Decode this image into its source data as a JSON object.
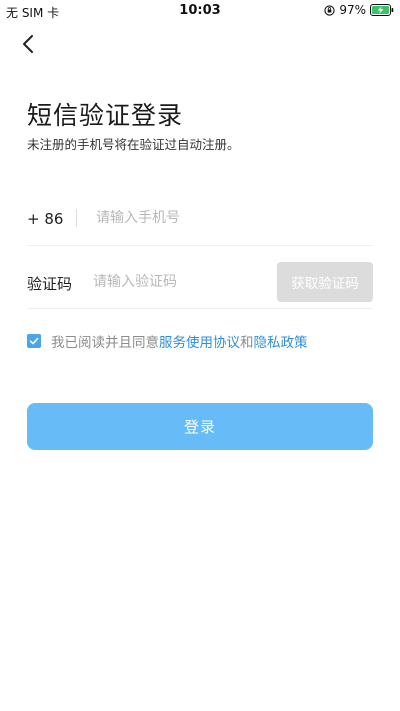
{
  "status_bar": {
    "carrier": "无 SIM 卡",
    "time": "10:03",
    "battery": "97%",
    "icons": [
      "rotation-lock-icon",
      "battery-charging-icon"
    ]
  },
  "nav": {
    "back_icon": "chevron-left-icon"
  },
  "header": {
    "title": "短信验证登录",
    "subtitle": "未注册的手机号将在验证过自动注册。"
  },
  "phone": {
    "country_code": "+ 86",
    "placeholder": "请输入手机号",
    "value": ""
  },
  "code": {
    "label": "验证码",
    "placeholder": "请输入验证码",
    "value": "",
    "button_label": "获取验证码"
  },
  "agreement": {
    "checked": true,
    "prefix": "我已阅读并且同意",
    "link_terms": "服务使用协议",
    "conjunction": "和",
    "link_privacy": "隐私政策"
  },
  "actions": {
    "login_label": "登录"
  },
  "colors": {
    "accent": "#67bcf8",
    "link": "#2f8fd8",
    "checkbox": "#4aa6e8",
    "disabled_button": "#dcdcdc"
  }
}
